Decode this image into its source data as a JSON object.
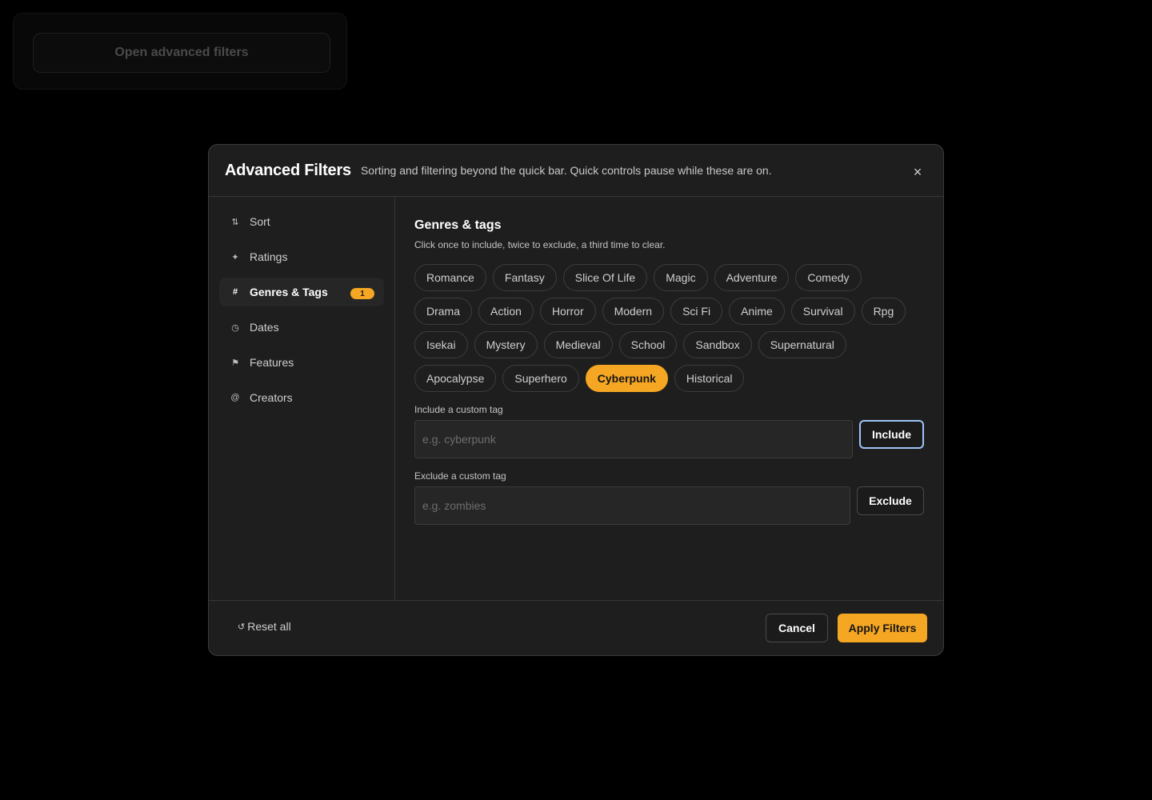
{
  "launcher": {
    "button_label": "Open advanced filters"
  },
  "modal": {
    "title": "Advanced Filters",
    "subtitle": "Sorting and filtering beyond the quick bar. Quick controls pause while these are on.",
    "close_icon": "×"
  },
  "sidebar": {
    "items": [
      {
        "icon": "⇅",
        "icon_name": "sort-icon",
        "label": "Sort"
      },
      {
        "icon": "✦",
        "icon_name": "sparkle-icon",
        "label": "Ratings"
      },
      {
        "icon": "#",
        "icon_name": "hash-icon",
        "label": "Genres & Tags",
        "active": true,
        "badge": "1"
      },
      {
        "icon": "◷",
        "icon_name": "clock-icon",
        "label": "Dates"
      },
      {
        "icon": "⚑",
        "icon_name": "flag-icon",
        "label": "Features"
      },
      {
        "icon": "@",
        "icon_name": "at-icon",
        "label": "Creators"
      }
    ]
  },
  "content": {
    "title": "Genres & tags",
    "hint": "Click once to include, twice to exclude, a third time to clear.",
    "tag_rows": [
      [
        "Romance",
        "Fantasy",
        "Slice Of Life",
        "Magic",
        "Adventure",
        "Comedy"
      ],
      [
        "Drama",
        "Action",
        "Horror",
        "Modern",
        "Sci Fi",
        "Anime",
        "Survival",
        "Rpg"
      ],
      [
        "Isekai",
        "Mystery",
        "Medieval",
        "School",
        "Sandbox",
        "Supernatural"
      ],
      [
        "Apocalypse",
        "Superhero",
        "Cyberpunk",
        "Historical"
      ]
    ],
    "selected_tag": "Cyberpunk",
    "include_field": {
      "label": "Include a custom tag",
      "placeholder": "e.g. cyberpunk",
      "value": "",
      "button": "Include"
    },
    "exclude_field": {
      "label": "Exclude a custom tag",
      "placeholder": "e.g. zombies",
      "value": "",
      "button": "Exclude"
    }
  },
  "footer": {
    "reset_icon": "↺",
    "reset_label": "Reset all",
    "cancel_label": "Cancel",
    "apply_label": "Apply Filters"
  },
  "colors": {
    "accent": "#f5a623",
    "background": "#000000",
    "panel": "#1e1e1e",
    "focus_ring": "#9ec3f5"
  }
}
